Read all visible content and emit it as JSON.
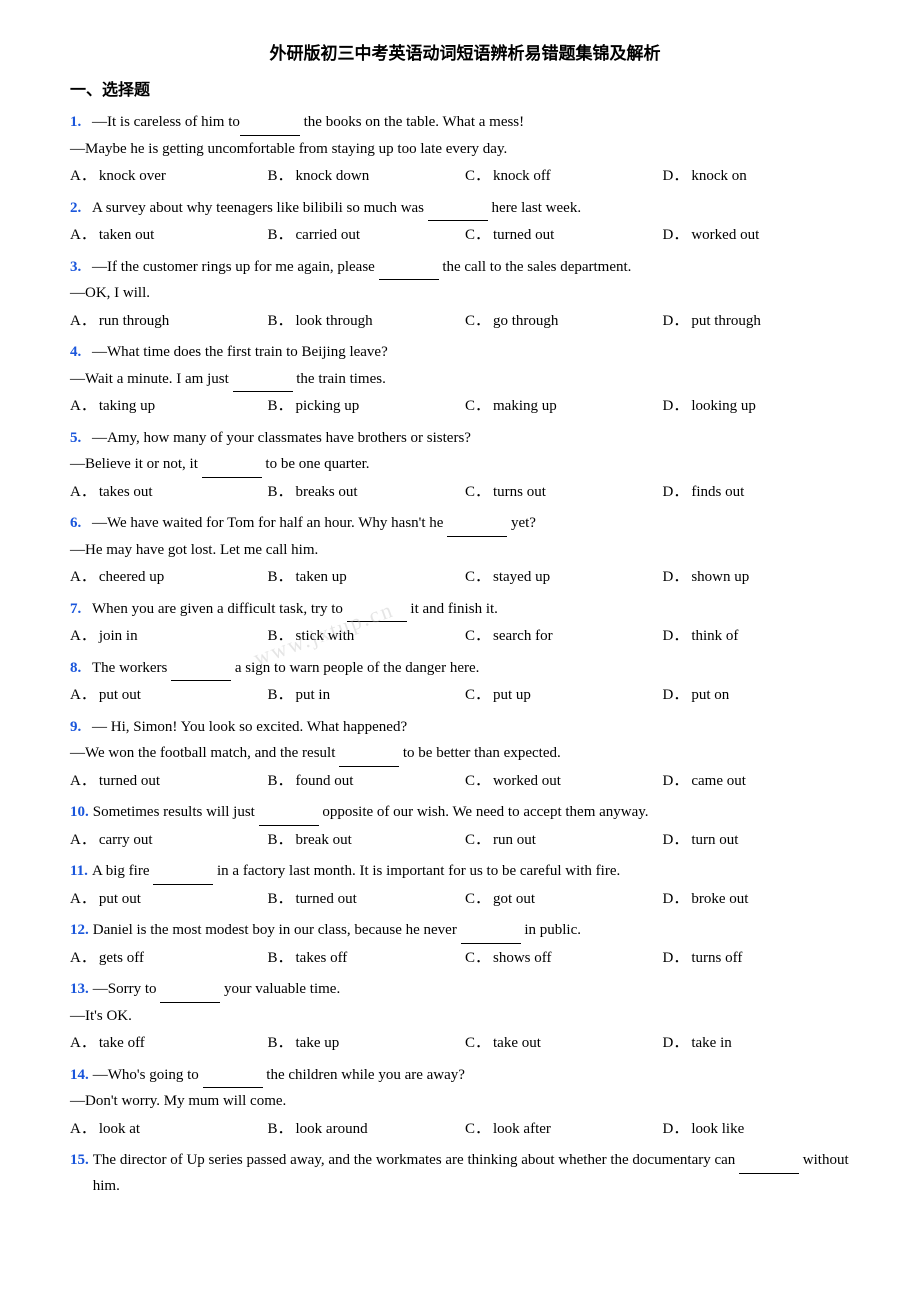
{
  "title": "外研版初三中考英语动词短语辨析易错题集锦及解析",
  "section": "一、选择题",
  "watermark": "www.jxtup.cn",
  "questions": [
    {
      "num": "1.",
      "lines": [
        "—It is careless of him to________ the books on the table. What a mess!",
        "—Maybe he is getting uncomfortable from staying up too late every day."
      ],
      "options": [
        {
          "letter": "A．",
          "text": "knock over"
        },
        {
          "letter": "B．",
          "text": "knock down"
        },
        {
          "letter": "C．",
          "text": "knock off"
        },
        {
          "letter": "D．",
          "text": "knock on"
        }
      ]
    },
    {
      "num": "2.",
      "lines": [
        "A survey about why teenagers like bilibili so much was ________ here last week."
      ],
      "options": [
        {
          "letter": "A．",
          "text": "taken out"
        },
        {
          "letter": "B．",
          "text": "carried out"
        },
        {
          "letter": "C．",
          "text": "turned out"
        },
        {
          "letter": "D．",
          "text": "worked out"
        }
      ]
    },
    {
      "num": "3.",
      "lines": [
        "—If the customer rings up for me again, please ________ the call to the sales department.",
        "—OK, I will."
      ],
      "options": [
        {
          "letter": "A．",
          "text": "run through"
        },
        {
          "letter": "B．",
          "text": "look through"
        },
        {
          "letter": "C．",
          "text": "go through"
        },
        {
          "letter": "D．",
          "text": "put through"
        }
      ]
    },
    {
      "num": "4.",
      "lines": [
        "—What time does the first train to Beijing leave?",
        "—Wait a minute. I am just ________ the train times."
      ],
      "options": [
        {
          "letter": "A．",
          "text": "taking up"
        },
        {
          "letter": "B．",
          "text": "picking up"
        },
        {
          "letter": "C．",
          "text": "making up"
        },
        {
          "letter": "D．",
          "text": "looking up"
        }
      ]
    },
    {
      "num": "5.",
      "lines": [
        "—Amy, how many of your classmates have brothers or sisters?",
        "—Believe it or not, it ________ to be one quarter."
      ],
      "options": [
        {
          "letter": "A．",
          "text": "takes out"
        },
        {
          "letter": "B．",
          "text": "breaks out"
        },
        {
          "letter": "C．",
          "text": "turns out"
        },
        {
          "letter": "D．",
          "text": "finds out"
        }
      ]
    },
    {
      "num": "6.",
      "lines": [
        "—We have waited for Tom for half an hour. Why hasn't he ________ yet?",
        "—He may have got lost. Let me call him."
      ],
      "options": [
        {
          "letter": "A．",
          "text": "cheered up"
        },
        {
          "letter": "B．",
          "text": "taken up"
        },
        {
          "letter": "C．",
          "text": "stayed up"
        },
        {
          "letter": "D．",
          "text": "shown up"
        }
      ]
    },
    {
      "num": "7.",
      "lines": [
        "When you are given a difficult task, try to ________ it and finish it."
      ],
      "options": [
        {
          "letter": "A．",
          "text": "join in"
        },
        {
          "letter": "B．",
          "text": "stick with"
        },
        {
          "letter": "C．",
          "text": "search for"
        },
        {
          "letter": "D．",
          "text": "think of"
        }
      ]
    },
    {
      "num": "8.",
      "lines": [
        "The workers ________ a sign to warn people of the danger here."
      ],
      "options": [
        {
          "letter": "A．",
          "text": "put out"
        },
        {
          "letter": "B．",
          "text": "put in"
        },
        {
          "letter": "C．",
          "text": "put up"
        },
        {
          "letter": "D．",
          "text": "put on"
        }
      ]
    },
    {
      "num": "9.",
      "lines": [
        "— Hi, Simon! You look so excited. What happened?",
        "—We won the football match, and the result ________ to be better than expected."
      ],
      "options": [
        {
          "letter": "A．",
          "text": "turned out"
        },
        {
          "letter": "B．",
          "text": "found out"
        },
        {
          "letter": "C．",
          "text": "worked out"
        },
        {
          "letter": "D．",
          "text": "came out"
        }
      ]
    },
    {
      "num": "10.",
      "lines": [
        "Sometimes results will just ________ opposite of our wish. We need to accept them anyway."
      ],
      "options": [
        {
          "letter": "A．",
          "text": "carry out"
        },
        {
          "letter": "B．",
          "text": "break out"
        },
        {
          "letter": "C．",
          "text": "run out"
        },
        {
          "letter": "D．",
          "text": "turn out"
        }
      ]
    },
    {
      "num": "11.",
      "lines": [
        "A big fire ________ in a factory last month. It is important for us to be careful with fire."
      ],
      "options": [
        {
          "letter": "A．",
          "text": "put out"
        },
        {
          "letter": "B．",
          "text": "turned out"
        },
        {
          "letter": "C．",
          "text": "got out"
        },
        {
          "letter": "D．",
          "text": "broke out"
        }
      ]
    },
    {
      "num": "12.",
      "lines": [
        "Daniel is the most modest boy in our class, because he never ________ in public."
      ],
      "options": [
        {
          "letter": "A．",
          "text": "gets off"
        },
        {
          "letter": "B．",
          "text": "takes off"
        },
        {
          "letter": "C．",
          "text": "shows off"
        },
        {
          "letter": "D．",
          "text": "turns off"
        }
      ]
    },
    {
      "num": "13.",
      "lines": [
        "—Sorry to ________ your valuable time.",
        "—It's OK."
      ],
      "options": [
        {
          "letter": "A．",
          "text": "take off"
        },
        {
          "letter": "B．",
          "text": "take up"
        },
        {
          "letter": "C．",
          "text": "take out"
        },
        {
          "letter": "D．",
          "text": "take in"
        }
      ]
    },
    {
      "num": "14.",
      "lines": [
        "—Who's going to ________ the children while you are away?",
        "—Don't worry. My mum will come."
      ],
      "options": [
        {
          "letter": "A．",
          "text": "look at"
        },
        {
          "letter": "B．",
          "text": "look around"
        },
        {
          "letter": "C．",
          "text": "look after"
        },
        {
          "letter": "D．",
          "text": "look like"
        }
      ]
    },
    {
      "num": "15.",
      "lines": [
        "The director of Up series passed away, and the workmates are thinking about whether the documentary can ________ without him."
      ],
      "options": []
    }
  ]
}
